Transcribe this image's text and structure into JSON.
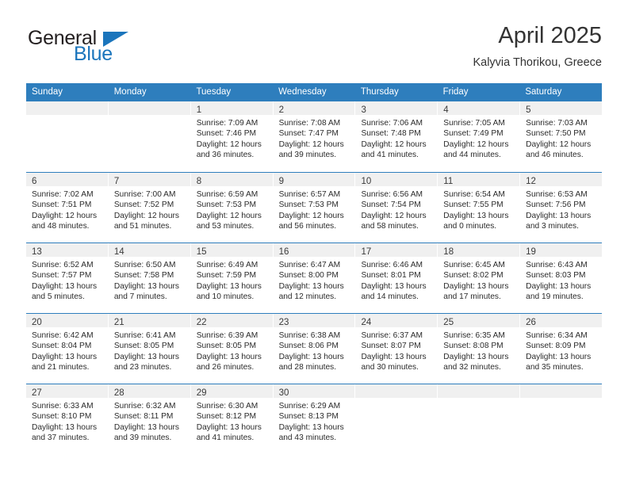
{
  "brand": {
    "name_top": "General",
    "name_bottom": "Blue"
  },
  "header": {
    "title": "April 2025",
    "subtitle": "Kalyvia Thorikou, Greece"
  },
  "colors": {
    "header_blue": "#2e7ebd",
    "brand_blue": "#1b75bc",
    "daynum_band": "#f0f0f0",
    "text": "#2b2b2b"
  },
  "weekdays": [
    "Sunday",
    "Monday",
    "Tuesday",
    "Wednesday",
    "Thursday",
    "Friday",
    "Saturday"
  ],
  "weeks": [
    [
      {
        "day": "",
        "sunrise": "",
        "sunset": "",
        "daylight_1": "",
        "daylight_2": "",
        "empty": true
      },
      {
        "day": "",
        "sunrise": "",
        "sunset": "",
        "daylight_1": "",
        "daylight_2": "",
        "empty": true
      },
      {
        "day": "1",
        "sunrise": "Sunrise: 7:09 AM",
        "sunset": "Sunset: 7:46 PM",
        "daylight_1": "Daylight: 12 hours",
        "daylight_2": "and 36 minutes."
      },
      {
        "day": "2",
        "sunrise": "Sunrise: 7:08 AM",
        "sunset": "Sunset: 7:47 PM",
        "daylight_1": "Daylight: 12 hours",
        "daylight_2": "and 39 minutes."
      },
      {
        "day": "3",
        "sunrise": "Sunrise: 7:06 AM",
        "sunset": "Sunset: 7:48 PM",
        "daylight_1": "Daylight: 12 hours",
        "daylight_2": "and 41 minutes."
      },
      {
        "day": "4",
        "sunrise": "Sunrise: 7:05 AM",
        "sunset": "Sunset: 7:49 PM",
        "daylight_1": "Daylight: 12 hours",
        "daylight_2": "and 44 minutes."
      },
      {
        "day": "5",
        "sunrise": "Sunrise: 7:03 AM",
        "sunset": "Sunset: 7:50 PM",
        "daylight_1": "Daylight: 12 hours",
        "daylight_2": "and 46 minutes."
      }
    ],
    [
      {
        "day": "6",
        "sunrise": "Sunrise: 7:02 AM",
        "sunset": "Sunset: 7:51 PM",
        "daylight_1": "Daylight: 12 hours",
        "daylight_2": "and 48 minutes."
      },
      {
        "day": "7",
        "sunrise": "Sunrise: 7:00 AM",
        "sunset": "Sunset: 7:52 PM",
        "daylight_1": "Daylight: 12 hours",
        "daylight_2": "and 51 minutes."
      },
      {
        "day": "8",
        "sunrise": "Sunrise: 6:59 AM",
        "sunset": "Sunset: 7:53 PM",
        "daylight_1": "Daylight: 12 hours",
        "daylight_2": "and 53 minutes."
      },
      {
        "day": "9",
        "sunrise": "Sunrise: 6:57 AM",
        "sunset": "Sunset: 7:53 PM",
        "daylight_1": "Daylight: 12 hours",
        "daylight_2": "and 56 minutes."
      },
      {
        "day": "10",
        "sunrise": "Sunrise: 6:56 AM",
        "sunset": "Sunset: 7:54 PM",
        "daylight_1": "Daylight: 12 hours",
        "daylight_2": "and 58 minutes."
      },
      {
        "day": "11",
        "sunrise": "Sunrise: 6:54 AM",
        "sunset": "Sunset: 7:55 PM",
        "daylight_1": "Daylight: 13 hours",
        "daylight_2": "and 0 minutes."
      },
      {
        "day": "12",
        "sunrise": "Sunrise: 6:53 AM",
        "sunset": "Sunset: 7:56 PM",
        "daylight_1": "Daylight: 13 hours",
        "daylight_2": "and 3 minutes."
      }
    ],
    [
      {
        "day": "13",
        "sunrise": "Sunrise: 6:52 AM",
        "sunset": "Sunset: 7:57 PM",
        "daylight_1": "Daylight: 13 hours",
        "daylight_2": "and 5 minutes."
      },
      {
        "day": "14",
        "sunrise": "Sunrise: 6:50 AM",
        "sunset": "Sunset: 7:58 PM",
        "daylight_1": "Daylight: 13 hours",
        "daylight_2": "and 7 minutes."
      },
      {
        "day": "15",
        "sunrise": "Sunrise: 6:49 AM",
        "sunset": "Sunset: 7:59 PM",
        "daylight_1": "Daylight: 13 hours",
        "daylight_2": "and 10 minutes."
      },
      {
        "day": "16",
        "sunrise": "Sunrise: 6:47 AM",
        "sunset": "Sunset: 8:00 PM",
        "daylight_1": "Daylight: 13 hours",
        "daylight_2": "and 12 minutes."
      },
      {
        "day": "17",
        "sunrise": "Sunrise: 6:46 AM",
        "sunset": "Sunset: 8:01 PM",
        "daylight_1": "Daylight: 13 hours",
        "daylight_2": "and 14 minutes."
      },
      {
        "day": "18",
        "sunrise": "Sunrise: 6:45 AM",
        "sunset": "Sunset: 8:02 PM",
        "daylight_1": "Daylight: 13 hours",
        "daylight_2": "and 17 minutes."
      },
      {
        "day": "19",
        "sunrise": "Sunrise: 6:43 AM",
        "sunset": "Sunset: 8:03 PM",
        "daylight_1": "Daylight: 13 hours",
        "daylight_2": "and 19 minutes."
      }
    ],
    [
      {
        "day": "20",
        "sunrise": "Sunrise: 6:42 AM",
        "sunset": "Sunset: 8:04 PM",
        "daylight_1": "Daylight: 13 hours",
        "daylight_2": "and 21 minutes."
      },
      {
        "day": "21",
        "sunrise": "Sunrise: 6:41 AM",
        "sunset": "Sunset: 8:05 PM",
        "daylight_1": "Daylight: 13 hours",
        "daylight_2": "and 23 minutes."
      },
      {
        "day": "22",
        "sunrise": "Sunrise: 6:39 AM",
        "sunset": "Sunset: 8:05 PM",
        "daylight_1": "Daylight: 13 hours",
        "daylight_2": "and 26 minutes."
      },
      {
        "day": "23",
        "sunrise": "Sunrise: 6:38 AM",
        "sunset": "Sunset: 8:06 PM",
        "daylight_1": "Daylight: 13 hours",
        "daylight_2": "and 28 minutes."
      },
      {
        "day": "24",
        "sunrise": "Sunrise: 6:37 AM",
        "sunset": "Sunset: 8:07 PM",
        "daylight_1": "Daylight: 13 hours",
        "daylight_2": "and 30 minutes."
      },
      {
        "day": "25",
        "sunrise": "Sunrise: 6:35 AM",
        "sunset": "Sunset: 8:08 PM",
        "daylight_1": "Daylight: 13 hours",
        "daylight_2": "and 32 minutes."
      },
      {
        "day": "26",
        "sunrise": "Sunrise: 6:34 AM",
        "sunset": "Sunset: 8:09 PM",
        "daylight_1": "Daylight: 13 hours",
        "daylight_2": "and 35 minutes."
      }
    ],
    [
      {
        "day": "27",
        "sunrise": "Sunrise: 6:33 AM",
        "sunset": "Sunset: 8:10 PM",
        "daylight_1": "Daylight: 13 hours",
        "daylight_2": "and 37 minutes."
      },
      {
        "day": "28",
        "sunrise": "Sunrise: 6:32 AM",
        "sunset": "Sunset: 8:11 PM",
        "daylight_1": "Daylight: 13 hours",
        "daylight_2": "and 39 minutes."
      },
      {
        "day": "29",
        "sunrise": "Sunrise: 6:30 AM",
        "sunset": "Sunset: 8:12 PM",
        "daylight_1": "Daylight: 13 hours",
        "daylight_2": "and 41 minutes."
      },
      {
        "day": "30",
        "sunrise": "Sunrise: 6:29 AM",
        "sunset": "Sunset: 8:13 PM",
        "daylight_1": "Daylight: 13 hours",
        "daylight_2": "and 43 minutes."
      },
      {
        "day": "",
        "sunrise": "",
        "sunset": "",
        "daylight_1": "",
        "daylight_2": "",
        "empty": true
      },
      {
        "day": "",
        "sunrise": "",
        "sunset": "",
        "daylight_1": "",
        "daylight_2": "",
        "empty": true
      },
      {
        "day": "",
        "sunrise": "",
        "sunset": "",
        "daylight_1": "",
        "daylight_2": "",
        "empty": true
      }
    ]
  ]
}
